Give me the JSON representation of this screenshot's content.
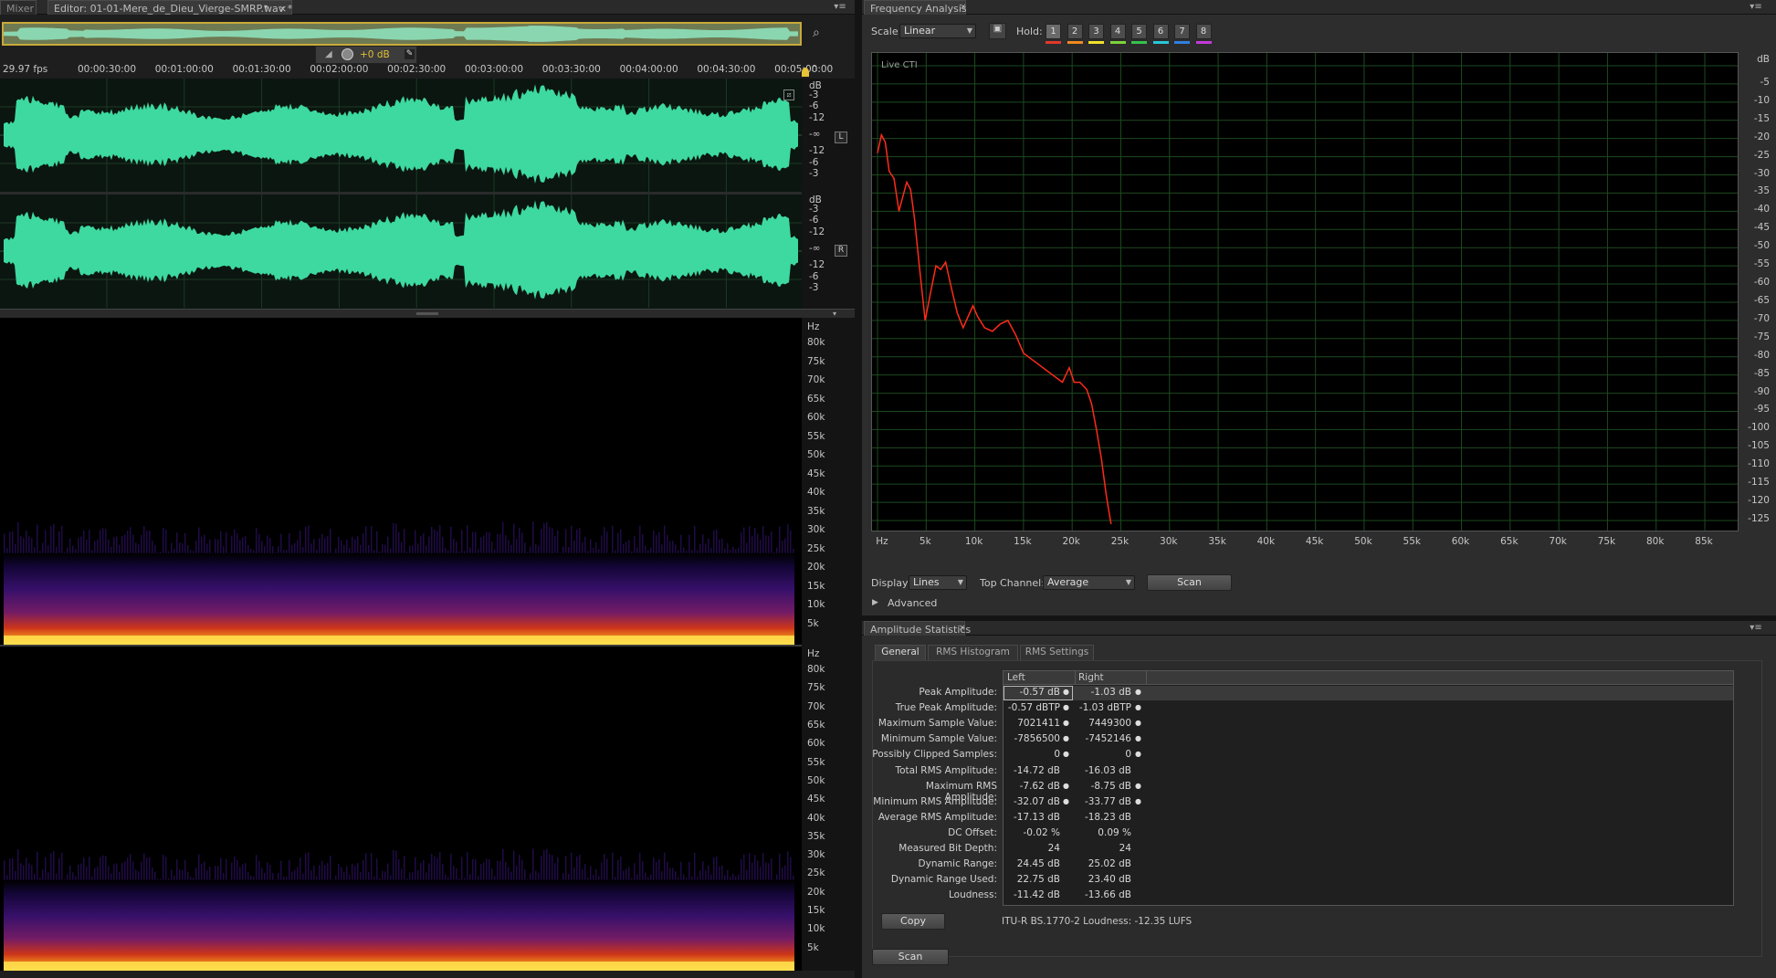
{
  "editor": {
    "tabs": [
      {
        "label": "Mixer"
      },
      {
        "label": "Editor: 01-01-Mere_de_Dieu_Vierge-SMRP.wav *"
      }
    ],
    "hud_gain": "+0 dB",
    "time_ruler": {
      "fps": "29.97 fps",
      "ticks": [
        "00:00:30:00",
        "00:01:00:00",
        "00:01:30:00",
        "00:02:00:00",
        "00:02:30:00",
        "00:03:00:00",
        "00:03:30:00",
        "00:04:00:00",
        "00:04:30:00",
        "00:05:00:00"
      ]
    },
    "waveform": {
      "channels": [
        {
          "label": "L",
          "db_scale": [
            "dB",
            "-3",
            "-6",
            "-12",
            "-∞",
            "-12",
            "-6",
            "-3"
          ]
        },
        {
          "label": "R",
          "db_scale": [
            "dB",
            "-3",
            "-6",
            "-12",
            "-∞",
            "-12",
            "-6",
            "-3"
          ]
        }
      ],
      "color": "#3dd9a0"
    },
    "spectral": {
      "hz_scale": [
        "Hz",
        "80k",
        "75k",
        "70k",
        "65k",
        "60k",
        "55k",
        "50k",
        "45k",
        "40k",
        "35k",
        "30k",
        "25k",
        "20k",
        "15k",
        "10k",
        "5k"
      ]
    }
  },
  "freq": {
    "title": "Frequency Analysis",
    "scale_label": "Scale:",
    "scale_value": "Linear",
    "hold_label": "Hold:",
    "hold_buttons": [
      {
        "label": "1",
        "color": "#e2382c"
      },
      {
        "label": "2",
        "color": "#f08a1e"
      },
      {
        "label": "3",
        "color": "#f2e12b"
      },
      {
        "label": "4",
        "color": "#7bd43a"
      },
      {
        "label": "5",
        "color": "#35c24a"
      },
      {
        "label": "6",
        "color": "#28c8d8"
      },
      {
        "label": "7",
        "color": "#2f7fe0"
      },
      {
        "label": "8",
        "color": "#c23ad8"
      }
    ],
    "graph_label": "Live CTI",
    "display_label": "Display:",
    "display_value": "Lines",
    "top_channel_label": "Top Channel:",
    "top_channel_value": "Average",
    "scan_label": "Scan",
    "advanced_label": "Advanced",
    "chart_data": {
      "type": "line",
      "x_ticks": [
        "Hz",
        "5k",
        "10k",
        "15k",
        "20k",
        "25k",
        "30k",
        "35k",
        "40k",
        "45k",
        "50k",
        "55k",
        "60k",
        "65k",
        "70k",
        "75k",
        "80k",
        "85k"
      ],
      "y_ticks": [
        "dB",
        "-5",
        "-10",
        "-15",
        "-20",
        "-25",
        "-30",
        "-35",
        "-40",
        "-45",
        "-50",
        "-55",
        "-60",
        "-65",
        "-70",
        "-75",
        "-80",
        "-85",
        "-90",
        "-95",
        "-100",
        "-105",
        "-110",
        "-115",
        "-120",
        "-125"
      ],
      "xlim": [
        0,
        88000
      ],
      "ylim": [
        -127,
        2
      ],
      "series": [
        {
          "color": "#ff2a1a",
          "points": [
            [
              0,
              -24
            ],
            [
              400,
              -19
            ],
            [
              800,
              -21
            ],
            [
              1200,
              -29
            ],
            [
              1700,
              -31
            ],
            [
              2200,
              -40
            ],
            [
              2600,
              -36
            ],
            [
              3000,
              -32
            ],
            [
              3400,
              -34
            ],
            [
              3800,
              -42
            ],
            [
              4300,
              -55
            ],
            [
              4900,
              -70
            ],
            [
              5400,
              -63
            ],
            [
              6000,
              -55
            ],
            [
              6500,
              -56
            ],
            [
              7000,
              -54
            ],
            [
              7500,
              -60
            ],
            [
              8200,
              -68
            ],
            [
              8800,
              -72
            ],
            [
              9300,
              -69
            ],
            [
              9800,
              -66
            ],
            [
              10300,
              -69
            ],
            [
              11000,
              -72
            ],
            [
              11800,
              -73
            ],
            [
              12600,
              -71
            ],
            [
              13400,
              -70
            ],
            [
              14200,
              -74
            ],
            [
              15000,
              -79
            ],
            [
              16000,
              -81
            ],
            [
              17000,
              -83
            ],
            [
              18000,
              -85
            ],
            [
              19000,
              -87
            ],
            [
              19700,
              -83
            ],
            [
              20200,
              -87
            ],
            [
              20800,
              -87
            ],
            [
              21500,
              -89
            ],
            [
              22000,
              -93
            ],
            [
              22500,
              -100
            ],
            [
              23000,
              -108
            ],
            [
              23500,
              -118
            ],
            [
              24000,
              -126
            ]
          ]
        }
      ]
    }
  },
  "amp": {
    "title": "Amplitude Statistics",
    "tabs": [
      "General",
      "RMS Histogram",
      "RMS Settings"
    ],
    "columns": [
      "Left",
      "Right"
    ],
    "rows": [
      {
        "label": "Peak Amplitude:",
        "left": "-0.57 dB",
        "right": "-1.03 dB",
        "pin": true
      },
      {
        "label": "True Peak Amplitude:",
        "left": "-0.57 dBTP",
        "right": "-1.03 dBTP",
        "pin": true
      },
      {
        "label": "Maximum Sample Value:",
        "left": "7021411",
        "right": "7449300",
        "pin": true
      },
      {
        "label": "Minimum Sample Value:",
        "left": "-7856500",
        "right": "-7452146",
        "pin": true
      },
      {
        "label": "Possibly Clipped Samples:",
        "left": "0",
        "right": "0",
        "pin": true
      },
      {
        "label": "Total RMS Amplitude:",
        "left": "-14.72 dB",
        "right": "-16.03 dB",
        "pin": false
      },
      {
        "label": "Maximum RMS Amplitude:",
        "left": "-7.62 dB",
        "right": "-8.75 dB",
        "pin": true
      },
      {
        "label": "Minimum RMS Amplitude:",
        "left": "-32.07 dB",
        "right": "-33.77 dB",
        "pin": true
      },
      {
        "label": "Average RMS Amplitude:",
        "left": "-17.13 dB",
        "right": "-18.23 dB",
        "pin": false
      },
      {
        "label": "DC Offset:",
        "left": "-0.02 %",
        "right": "0.09 %",
        "pin": false
      },
      {
        "label": "Measured Bit Depth:",
        "left": "24",
        "right": "24",
        "pin": false
      },
      {
        "label": "Dynamic Range:",
        "left": "24.45 dB",
        "right": "25.02 dB",
        "pin": false
      },
      {
        "label": "Dynamic Range Used:",
        "left": "22.75 dB",
        "right": "23.40 dB",
        "pin": false
      },
      {
        "label": "Loudness:",
        "left": "-11.42 dB",
        "right": "-13.66 dB",
        "pin": false
      }
    ],
    "copy_label": "Copy",
    "itu_text": "ITU-R BS.1770-2 Loudness: -12.35 LUFS",
    "scan_label": "Scan"
  }
}
